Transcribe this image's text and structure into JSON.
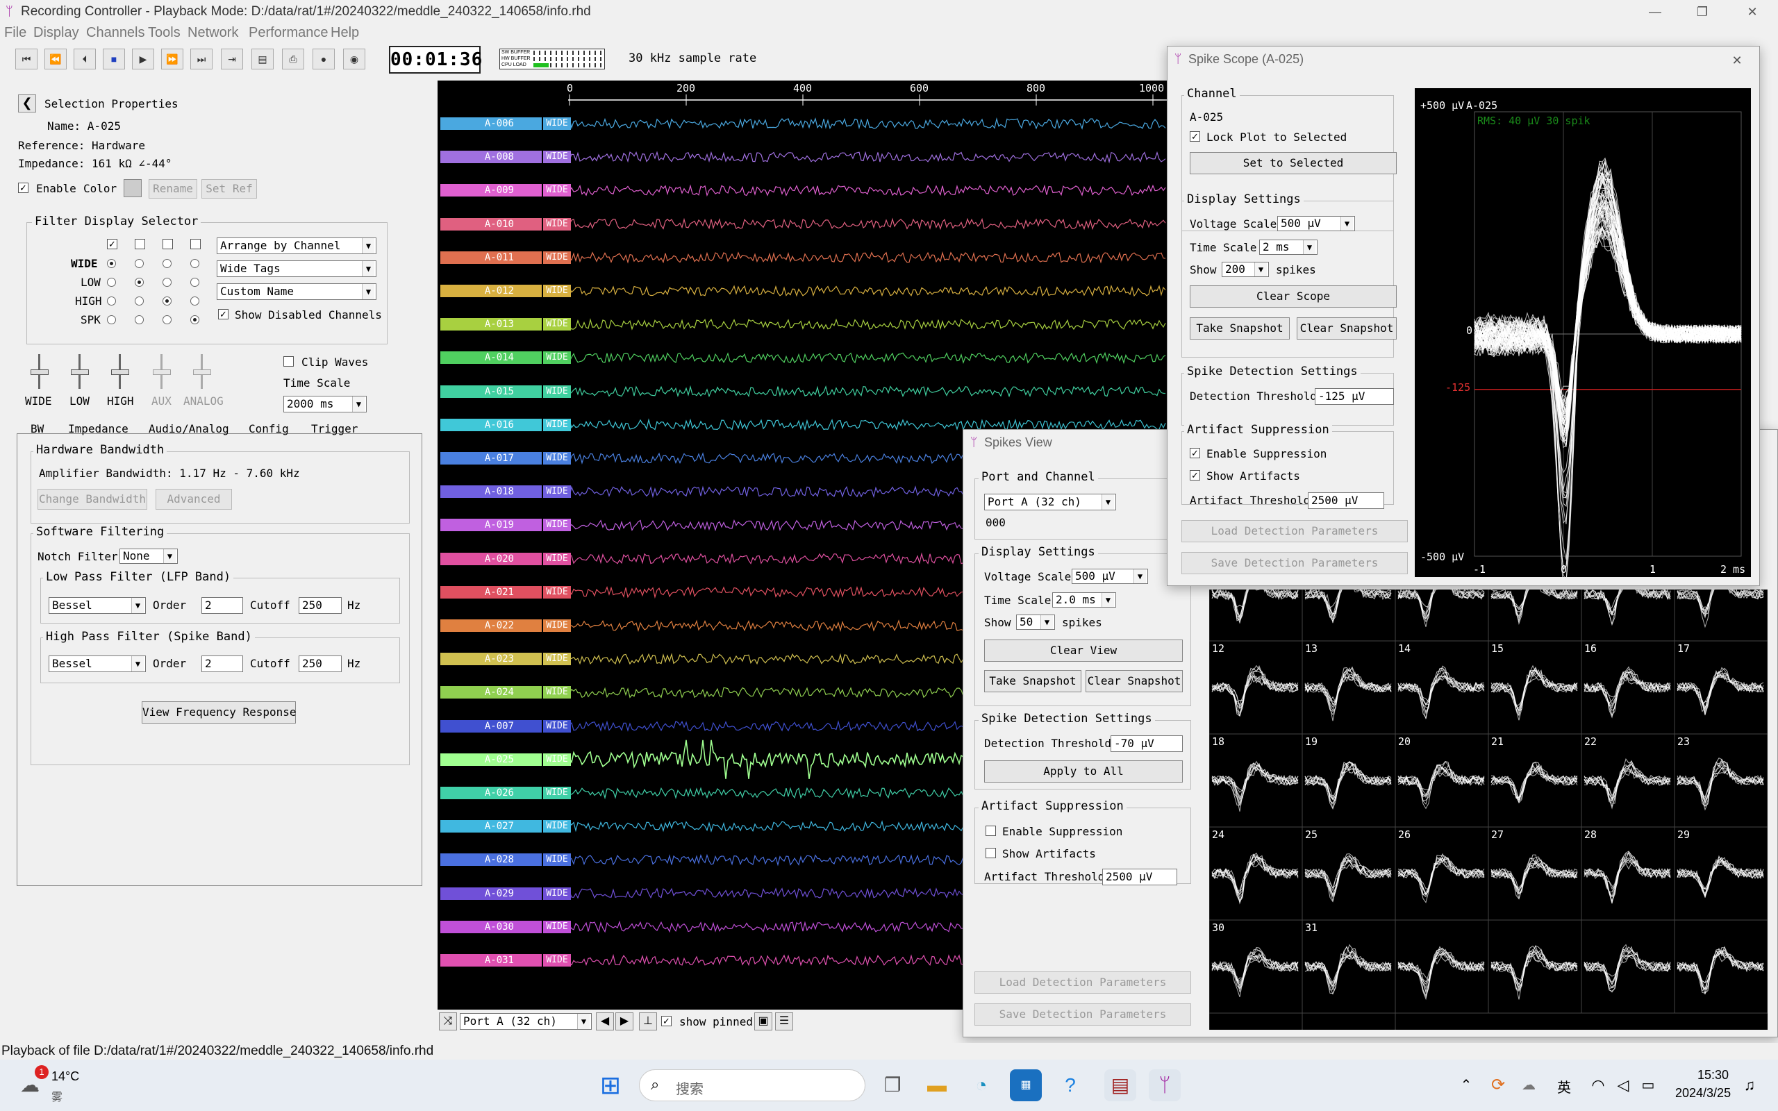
{
  "window": {
    "title": "Recording Controller - Playback Mode: D:/data/rat/1#/20240322/meddle_240322_140658/info.rhd"
  },
  "menu": [
    "File",
    "Display",
    "Channels",
    "Tools",
    "Network",
    "Performance",
    "Help"
  ],
  "toolbar": {
    "clock": "00:01:36",
    "buffer_labels": [
      "SW BUFFER",
      "HW BUFFER",
      "CPU LOAD"
    ],
    "sample_rate": "30 kHz sample rate"
  },
  "selection": {
    "heading": "Selection Properties",
    "name": "Name: A-025",
    "reference": "Reference: Hardware",
    "impedance": "Impedance: 161 kΩ ∠-44°",
    "enable": "Enable",
    "color": "Color",
    "rename": "Rename",
    "set_ref": "Set Ref"
  },
  "filter_display": {
    "title": "Filter Display Selector",
    "rows": [
      "WIDE",
      "LOW",
      "HIGH",
      "SPK"
    ],
    "arrange": "Arrange by Channel",
    "tags": "Wide Tags",
    "name_mode": "Custom Name",
    "show_disabled": "Show Disabled Channels"
  },
  "sliders": [
    "WIDE",
    "LOW",
    "HIGH",
    "AUX",
    "ANALOG"
  ],
  "clip_waves": "Clip Waves",
  "time_scale_label": "Time Scale",
  "time_scale": "2000 ms",
  "tabs": [
    "BW",
    "Impedance",
    "Audio/Analog",
    "Config",
    "Trigger"
  ],
  "hardware": {
    "title": "Hardware Bandwidth",
    "bandwidth": "Amplifier Bandwidth: 1.17 Hz - 7.60 kHz",
    "change": "Change Bandwidth",
    "advanced": "Advanced"
  },
  "software": {
    "title": "Software Filtering",
    "notch_label": "Notch Filter",
    "notch": "None",
    "lpf": {
      "title": "Low Pass Filter (LFP Band)",
      "type": "Bessel",
      "order_label": "Order",
      "order": "2",
      "cutoff_label": "Cutoff",
      "cutoff": "250",
      "unit": "Hz"
    },
    "hpf": {
      "title": "High Pass Filter (Spike Band)",
      "type": "Bessel",
      "order_label": "Order",
      "order": "2",
      "cutoff_label": "Cutoff",
      "cutoff": "250",
      "unit": "Hz"
    },
    "freq_btn": "View Frequency Response"
  },
  "ruler": [
    "0",
    "200",
    "400",
    "600",
    "800",
    "1000"
  ],
  "channels": [
    {
      "name": "A-006",
      "color": "#4aa8e0"
    },
    {
      "name": "A-008",
      "color": "#a070e0"
    },
    {
      "name": "A-009",
      "color": "#e060d0"
    },
    {
      "name": "A-010",
      "color": "#e06080"
    },
    {
      "name": "A-011",
      "color": "#e07050"
    },
    {
      "name": "A-012",
      "color": "#d8b040"
    },
    {
      "name": "A-013",
      "color": "#a8d040"
    },
    {
      "name": "A-014",
      "color": "#50d060"
    },
    {
      "name": "A-015",
      "color": "#40d0a0"
    },
    {
      "name": "A-016",
      "color": "#40c8d8"
    },
    {
      "name": "A-017",
      "color": "#4a80e0"
    },
    {
      "name": "A-018",
      "color": "#7060e0"
    },
    {
      "name": "A-019",
      "color": "#c060e0"
    },
    {
      "name": "A-020",
      "color": "#e050a0"
    },
    {
      "name": "A-021",
      "color": "#e05060"
    },
    {
      "name": "A-022",
      "color": "#e08040"
    },
    {
      "name": "A-023",
      "color": "#d0c050"
    },
    {
      "name": "A-024",
      "color": "#90d050"
    },
    {
      "name": "A-007",
      "color": "#4050d0"
    },
    {
      "name": "A-025",
      "color": "#a0ff90"
    },
    {
      "name": "A-026",
      "color": "#40d0a8"
    },
    {
      "name": "A-027",
      "color": "#40b8e0"
    },
    {
      "name": "A-028",
      "color": "#4a70e0"
    },
    {
      "name": "A-029",
      "color": "#7050d8"
    },
    {
      "name": "A-030",
      "color": "#c050d8"
    },
    {
      "name": "A-031",
      "color": "#e050b0"
    }
  ],
  "wide_tag": "WIDE",
  "bottom_bar": {
    "port": "Port A (32 ch)",
    "show_pinned": "show pinned"
  },
  "scope": {
    "title": "Spike Scope (A-025)",
    "channel_group": "Channel",
    "channel": "A-025",
    "lock": "Lock Plot to Selected",
    "set_selected": "Set to Selected",
    "display_group": "Display Settings",
    "voltage_label": "Voltage Scale",
    "voltage": "500 μV",
    "time_label": "Time Scale",
    "time": "2 ms",
    "show_label": "Show",
    "show": "200",
    "spikes": "spikes",
    "clear": "Clear Scope",
    "take": "Take Snapshot",
    "clear_snap": "Clear Snapshot",
    "detect_group": "Spike Detection Settings",
    "thresh_label": "Detection Threshold",
    "thresh": "-125 μV",
    "artifact_group": "Artifact Suppression",
    "enable_supp": "Enable Suppression",
    "show_art": "Show Artifacts",
    "art_label": "Artifact Threshold",
    "art": "2500 μV",
    "load": "Load Detection Parameters",
    "save": "Save Detection Parameters",
    "plot": {
      "top": "+500 μV",
      "bottom": "-500 μV",
      "zero": "0",
      "thr": "-125",
      "name": "A-025",
      "rms": "RMS: 40 μV  30 spik",
      "xt": [
        "-1",
        "0",
        "1",
        "2 ms"
      ]
    }
  },
  "spikes": {
    "title": "Spikes View",
    "port_group": "Port and Channel",
    "port": "Port A (32 ch)",
    "channel": "000",
    "display_group": "Display Settings",
    "voltage_label": "Voltage Scale",
    "voltage": "500 μV",
    "time_label": "Time Scale",
    "time": "2.0 ms",
    "show_label": "Show",
    "show": "50",
    "spikes": "spikes",
    "clear": "Clear View",
    "take": "Take Snapshot",
    "clear_snap": "Clear Snapshot",
    "detect_group": "Spike Detection Settings",
    "thresh_label": "Detection Threshold",
    "thresh": "-70 μV",
    "apply": "Apply to All",
    "artifact_group": "Artifact Suppression",
    "enable_supp": "Enable Suppression",
    "show_art": "Show Artifacts",
    "art_label": "Artifact Threshold",
    "art": "2500 μV",
    "load": "Load Detection Parameters",
    "save": "Save Detection Parameters",
    "grid_labels": [
      "12",
      "13",
      "14",
      "15",
      "16",
      "17",
      "18",
      "19",
      "20",
      "21",
      "22",
      "23",
      "24",
      "25",
      "26",
      "27",
      "28",
      "29",
      "30",
      "31"
    ]
  },
  "status": "Playback of file D:/data/rat/1#/20240322/meddle_240322_140658/info.rhd",
  "taskbar": {
    "weather_temp": "14°C",
    "weather_desc": "雾",
    "badge": "1",
    "search": "搜索",
    "ime": "英",
    "time": "15:30",
    "date": "2024/3/25"
  }
}
